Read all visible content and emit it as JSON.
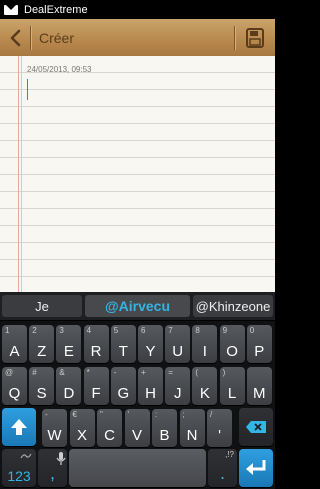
{
  "status": {
    "app_name": "DealExtreme"
  },
  "toolbar": {
    "title": "Créer"
  },
  "note": {
    "timestamp": "24/05/2013, 09:53"
  },
  "keyboard": {
    "suggestions": [
      "Je",
      "@Airvecu",
      "@Khinzeone"
    ],
    "row1": [
      {
        "main": "A",
        "alt": "1"
      },
      {
        "main": "Z",
        "alt": "2"
      },
      {
        "main": "E",
        "alt": "3"
      },
      {
        "main": "R",
        "alt": "4"
      },
      {
        "main": "T",
        "alt": "5"
      },
      {
        "main": "Y",
        "alt": "6"
      },
      {
        "main": "U",
        "alt": "7"
      },
      {
        "main": "I",
        "alt": "8"
      },
      {
        "main": "O",
        "alt": "9"
      },
      {
        "main": "P",
        "alt": "0"
      }
    ],
    "row2": [
      {
        "main": "Q",
        "alt": "@"
      },
      {
        "main": "S",
        "alt": "#"
      },
      {
        "main": "D",
        "alt": "&"
      },
      {
        "main": "F",
        "alt": "*"
      },
      {
        "main": "G",
        "alt": "-"
      },
      {
        "main": "H",
        "alt": "+"
      },
      {
        "main": "J",
        "alt": "="
      },
      {
        "main": "K",
        "alt": "("
      },
      {
        "main": "L",
        "alt": ")"
      },
      {
        "main": "M",
        "alt": ""
      }
    ],
    "row3": [
      {
        "main": "W",
        "alt": "-"
      },
      {
        "main": "X",
        "alt": "€"
      },
      {
        "main": "C",
        "alt": "\""
      },
      {
        "main": "V",
        "alt": "'"
      },
      {
        "main": "B",
        "alt": ":"
      },
      {
        "main": "N",
        "alt": ";"
      },
      {
        "main": "'",
        "alt": "/"
      }
    ],
    "num_label": "123",
    "comma": ",",
    "period": ".",
    "period_alt": ",!?"
  },
  "icons": {
    "back": "chevron-left-icon",
    "save": "save-icon",
    "shift": "shift-arrow-icon",
    "delete": "backspace-icon",
    "mic": "microphone-icon",
    "enter": "enter-arrow-icon"
  },
  "colors": {
    "accent": "#33b5e5",
    "toolbar": "#b98a4f",
    "paper": "#f9f7f2"
  }
}
